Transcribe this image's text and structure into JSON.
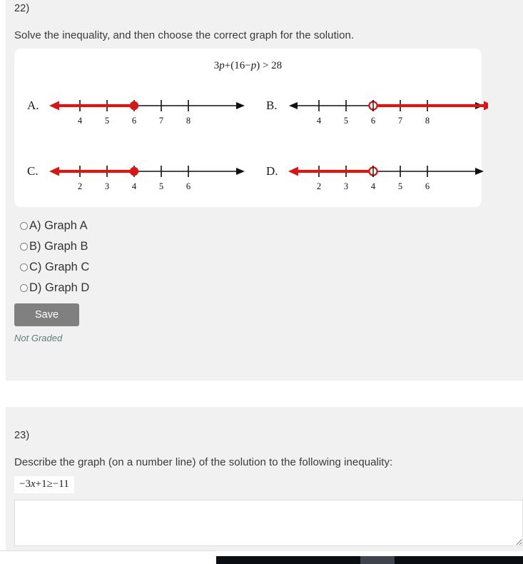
{
  "question22": {
    "number": "22)",
    "prompt": "Solve the inequality, and then choose the correct graph for the solution.",
    "formula_parts": {
      "lead": "3",
      "var1": "p",
      "mid": "+(16−",
      "var2": "p",
      "tail": ") > 28"
    },
    "formula_plain": "3p+(16−p) > 28",
    "graphs": [
      {
        "label": "A.",
        "ticks": [
          "4",
          "5",
          "6",
          "7",
          "8"
        ],
        "point_value": "6",
        "point_style": "closed",
        "ray_direction": "left",
        "ray_color": "#d41818"
      },
      {
        "label": "B.",
        "ticks": [
          "4",
          "5",
          "6",
          "7",
          "8"
        ],
        "point_value": "6",
        "point_style": "open",
        "ray_direction": "right",
        "ray_color": "#d41818"
      },
      {
        "label": "C.",
        "ticks": [
          "2",
          "3",
          "4",
          "5",
          "6"
        ],
        "point_value": "4",
        "point_style": "closed",
        "ray_direction": "left",
        "ray_color": "#d41818"
      },
      {
        "label": "D.",
        "ticks": [
          "2",
          "3",
          "4",
          "5",
          "6"
        ],
        "point_value": "4",
        "point_style": "open",
        "ray_direction": "left",
        "ray_color": "#d41818"
      }
    ],
    "choices": [
      {
        "label": "A) Graph A",
        "selected": false
      },
      {
        "label": "B) Graph B",
        "selected": false
      },
      {
        "label": "C) Graph C",
        "selected": false
      },
      {
        "label": "D) Graph D",
        "selected": false
      }
    ],
    "save_label": "Save",
    "status_label": "Not Graded"
  },
  "question23": {
    "number": "23)",
    "prompt": "Describe the graph (on a number line) of the solution to the following inequality:",
    "formula_parts": {
      "lead": "−3",
      "var1": "x",
      "tail": "+1≥−11"
    },
    "formula_plain": "−3x+1≥−11",
    "answer_value": ""
  },
  "colors": {
    "page_background": "#f1f1f1",
    "card_background": "#ffffff",
    "ray_red": "#d41818",
    "axis_black": "#111111",
    "save_button": "#808080",
    "not_graded_text": "#5f7d7d",
    "taskbar": "#0a0d12",
    "taskbar_active": "#3f444c"
  }
}
